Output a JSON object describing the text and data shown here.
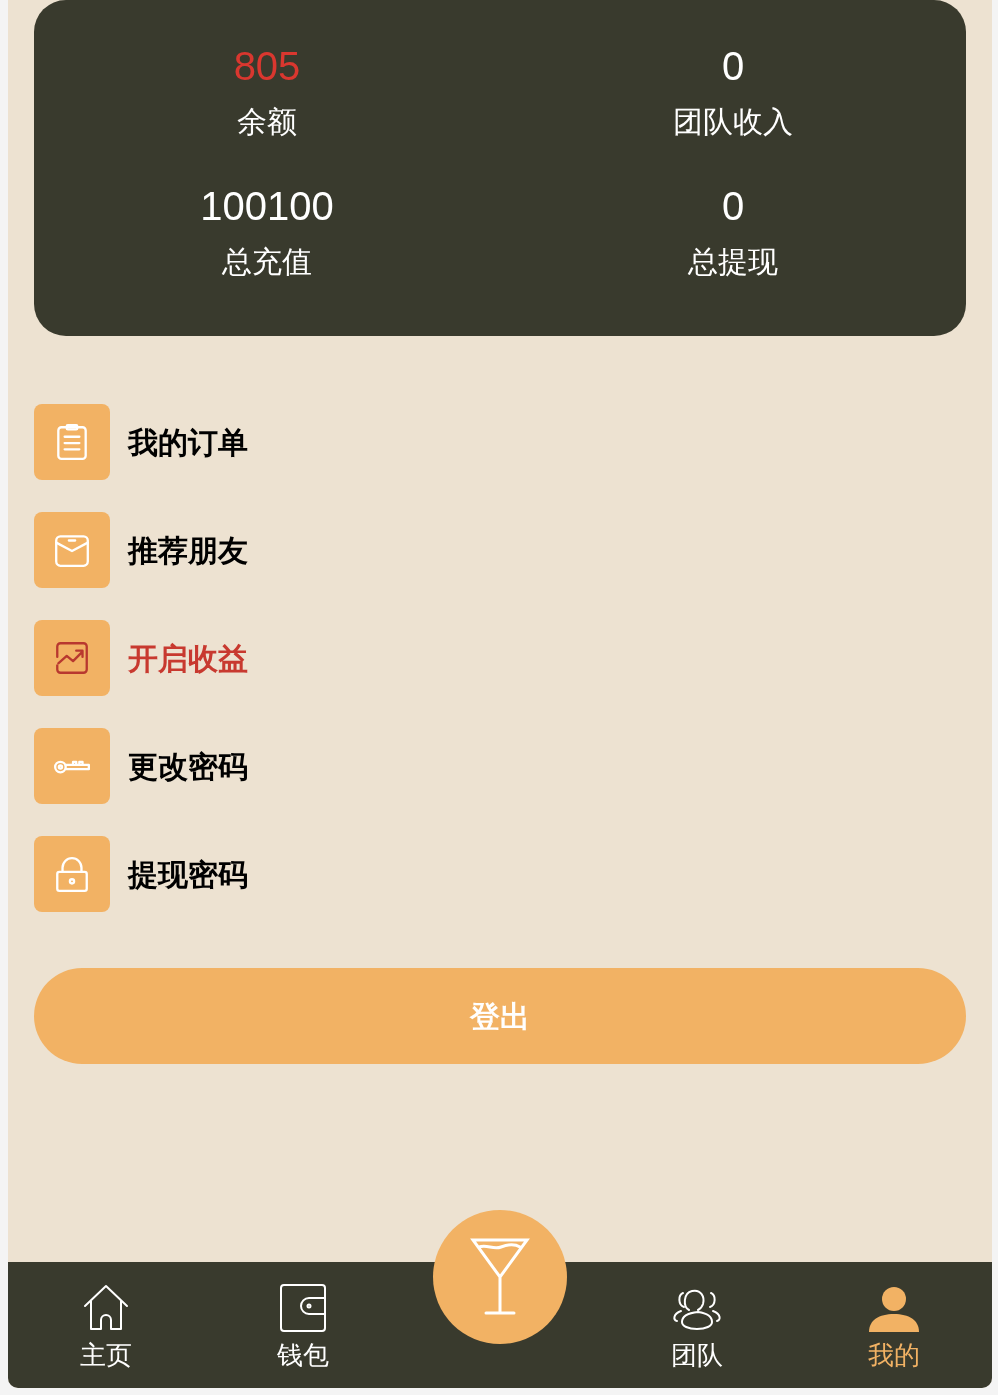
{
  "stats": [
    {
      "value": "805",
      "label": "余额",
      "highlighted": true
    },
    {
      "value": "0",
      "label": "团队收入",
      "highlighted": false
    },
    {
      "value": "100100",
      "label": "总充值",
      "highlighted": false
    },
    {
      "value": "0",
      "label": "总提现",
      "highlighted": false
    }
  ],
  "menu": [
    {
      "kind": "clipboard",
      "label": "我的订单",
      "highlighted": false
    },
    {
      "kind": "envelope",
      "label": "推荐朋友",
      "highlighted": false
    },
    {
      "kind": "chart",
      "label": "开启收益",
      "highlighted": true
    },
    {
      "kind": "key",
      "label": "更改密码",
      "highlighted": false
    },
    {
      "kind": "lock",
      "label": "提现密码",
      "highlighted": false
    }
  ],
  "logout_button": "登出",
  "nav": [
    {
      "kind": "home",
      "label": "主页",
      "selected": false
    },
    {
      "kind": "wallet",
      "label": "钱包",
      "selected": false
    },
    {
      "kind": "cocktail",
      "selected": false
    },
    {
      "kind": "team",
      "label": "团队",
      "selected": false
    },
    {
      "kind": "user",
      "label": "我的",
      "selected": true
    }
  ]
}
